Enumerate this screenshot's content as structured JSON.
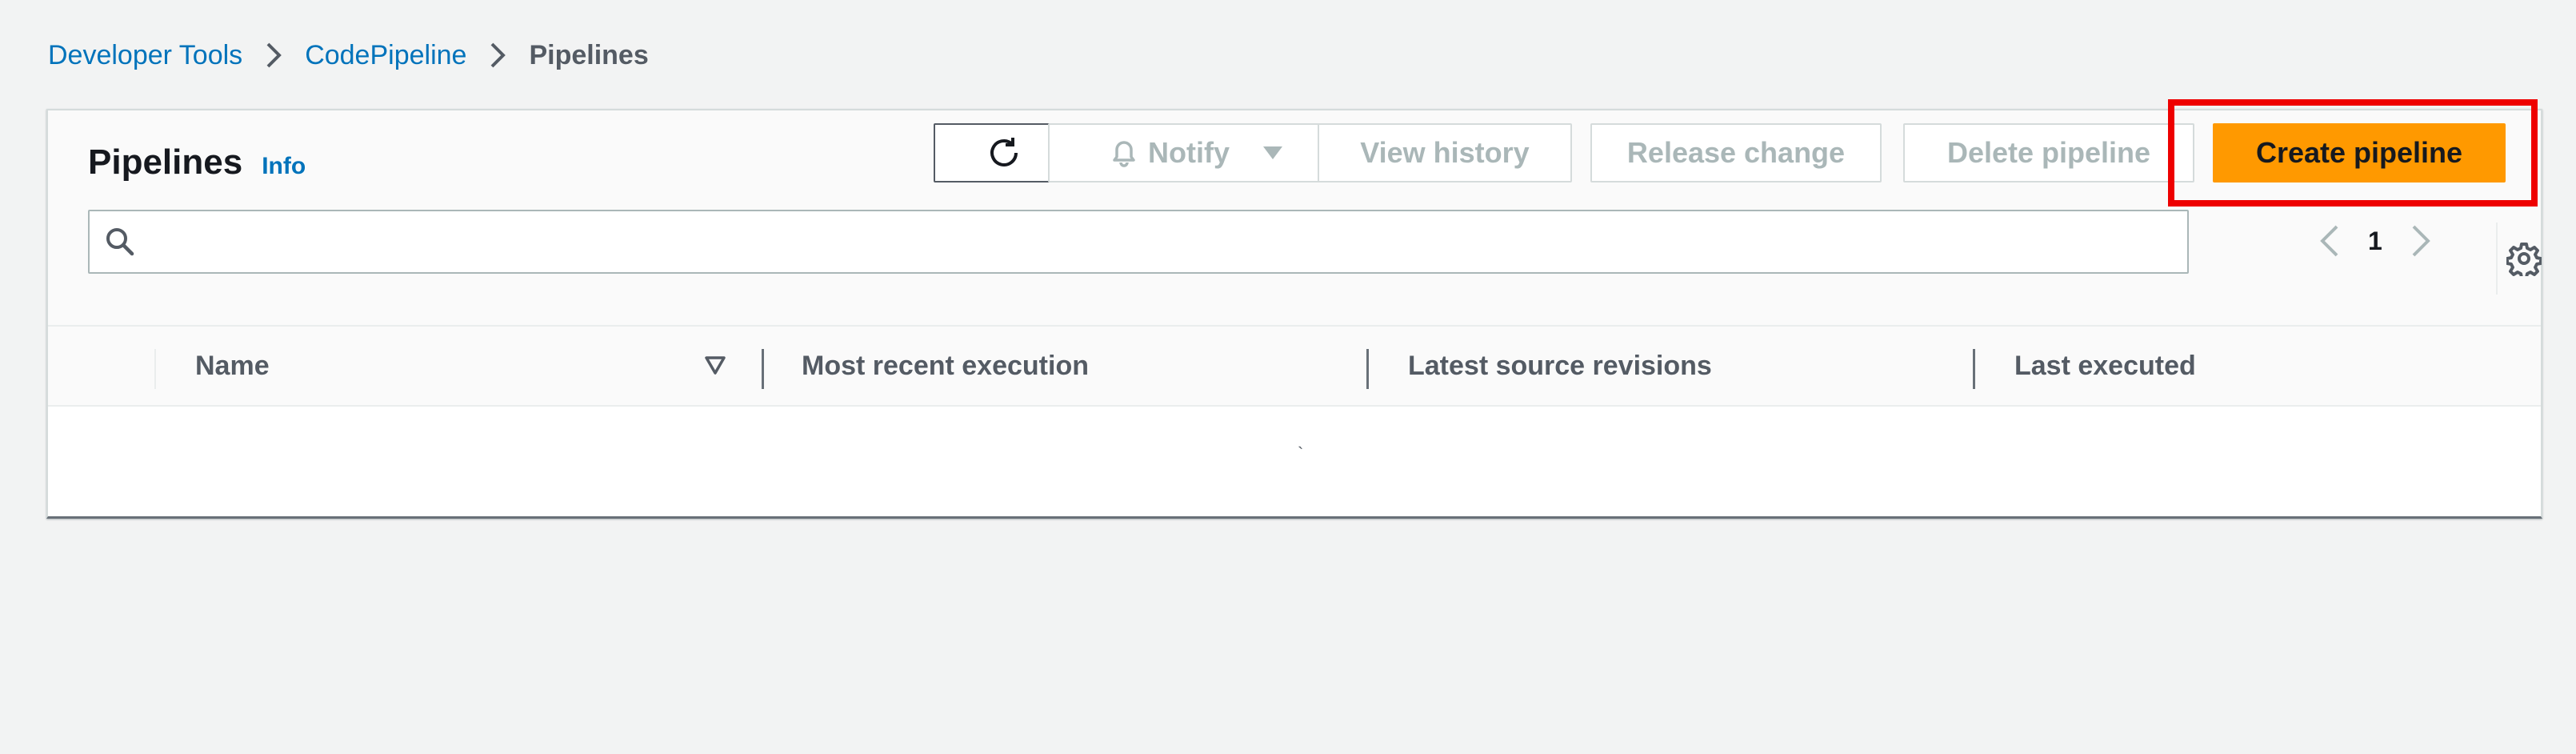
{
  "breadcrumb": {
    "items": [
      {
        "label": "Developer Tools"
      },
      {
        "label": "CodePipeline"
      }
    ],
    "current": "Pipelines"
  },
  "panel": {
    "title": "Pipelines",
    "info_label": "Info"
  },
  "actions": {
    "refresh_icon": "refresh-icon",
    "notify_label": "Notify",
    "view_history_label": "View history",
    "release_change_label": "Release change",
    "delete_pipeline_label": "Delete pipeline",
    "create_pipeline_label": "Create pipeline"
  },
  "search": {
    "value": "",
    "placeholder": ""
  },
  "pagination": {
    "current_page": "1"
  },
  "table": {
    "columns": [
      {
        "label": "Name"
      },
      {
        "label": "Most recent execution"
      },
      {
        "label": "Latest source revisions"
      },
      {
        "label": "Last executed"
      }
    ],
    "rows": [],
    "body_mark": "`"
  },
  "colors": {
    "link": "#0073bb",
    "primary_button": "#ff9900",
    "highlight": "#ee0000",
    "background": "#f2f3f3"
  }
}
